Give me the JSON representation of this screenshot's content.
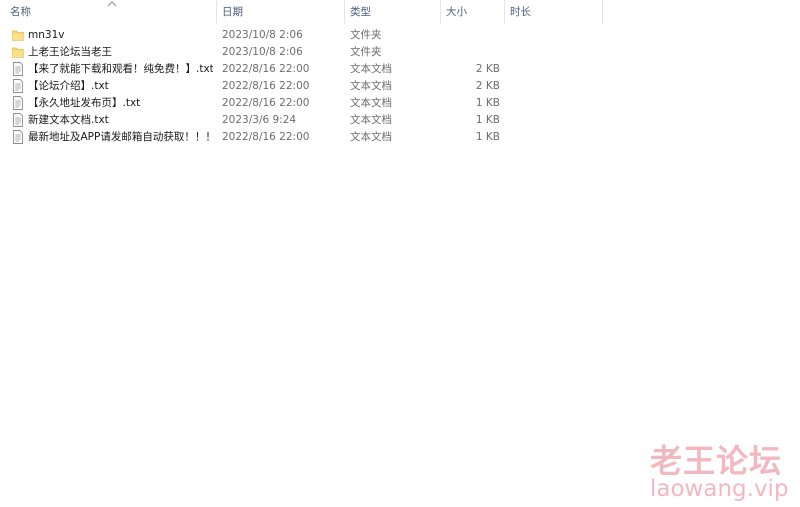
{
  "columns": {
    "name": "名称",
    "date": "日期",
    "type": "类型",
    "size": "大小",
    "duration": "时长"
  },
  "sort_icon": "chevron-up-icon",
  "files": [
    {
      "icon": "folder-icon",
      "name": "mn31v",
      "date": "2023/10/8 2:06",
      "type": "文件夹",
      "size": ""
    },
    {
      "icon": "folder-icon",
      "name": "上老王论坛当老王",
      "date": "2023/10/8 2:06",
      "type": "文件夹",
      "size": ""
    },
    {
      "icon": "text-file-icon",
      "name": "【来了就能下载和观看！纯免费！】.txt",
      "date": "2022/8/16 22:00",
      "type": "文本文档",
      "size": "2 KB"
    },
    {
      "icon": "text-file-icon",
      "name": "【论坛介绍】.txt",
      "date": "2022/8/16 22:00",
      "type": "文本文档",
      "size": "2 KB"
    },
    {
      "icon": "text-file-icon",
      "name": "【永久地址发布页】.txt",
      "date": "2022/8/16 22:00",
      "type": "文本文档",
      "size": "1 KB"
    },
    {
      "icon": "text-file-icon",
      "name": "新建文本文档.txt",
      "date": "2023/3/6 9:24",
      "type": "文本文档",
      "size": "1 KB"
    },
    {
      "icon": "text-file-icon",
      "name": "最新地址及APP请发邮箱自动获取！！！....",
      "date": "2022/8/16 22:00",
      "type": "文本文档",
      "size": "1 KB"
    }
  ],
  "watermark": {
    "title": "老王论坛",
    "url": "laowang.vip",
    "color": "#f2b8bf"
  },
  "colors": {
    "folder": "#f8d775",
    "header_text": "#4c607a",
    "secondary_text": "#6d6d6d"
  }
}
